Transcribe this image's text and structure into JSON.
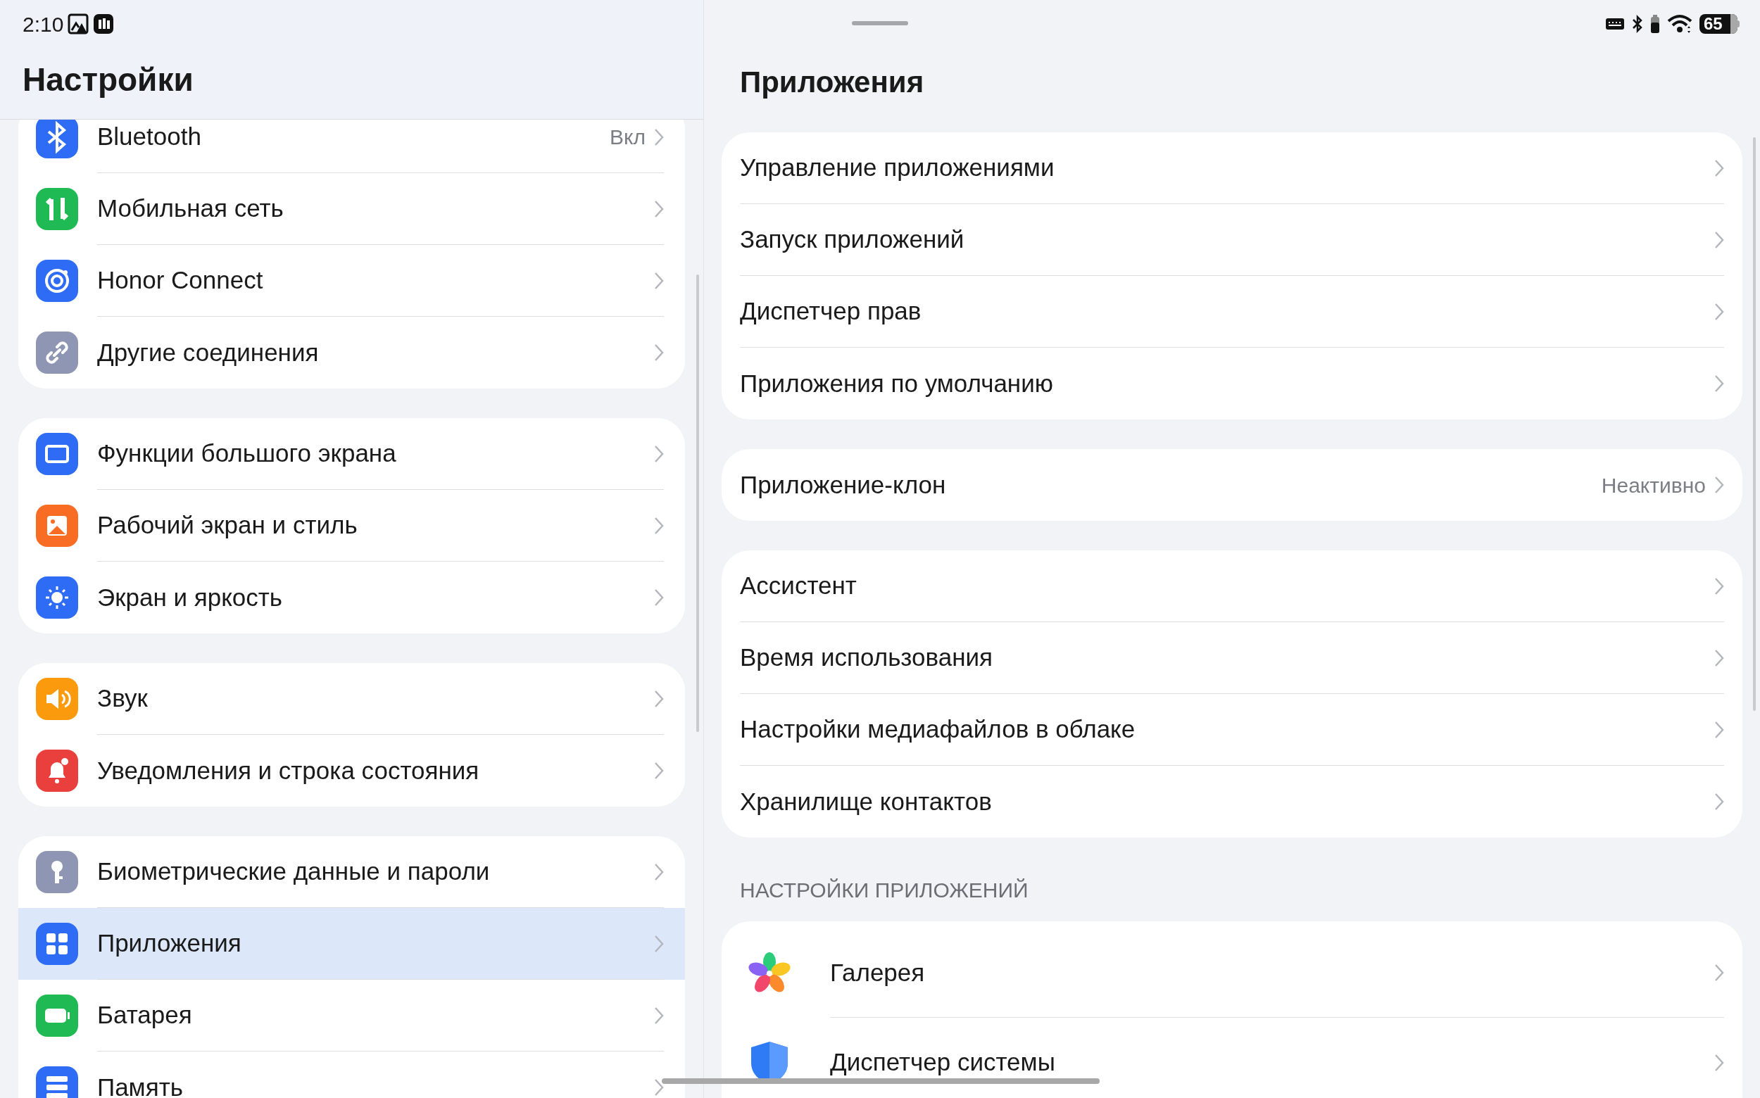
{
  "status_bar": {
    "time": "2:10",
    "battery": "65"
  },
  "left": {
    "title": "Настройки",
    "groups": [
      [
        {
          "kind": "bluetooth",
          "color": "#2f6cf6",
          "label": "Bluetooth",
          "value": "Вкл",
          "selected": false
        },
        {
          "kind": "mobile",
          "color": "#1fba54",
          "label": "Мобильная сеть",
          "selected": false
        },
        {
          "kind": "connect",
          "color": "#2f6cf6",
          "label": "Honor Connect",
          "selected": false
        },
        {
          "kind": "link",
          "color": "#8e96b4",
          "label": "Другие соединения",
          "selected": false
        }
      ],
      [
        {
          "kind": "screen",
          "color": "#2f6cf6",
          "label": "Функции большого экрана",
          "selected": false
        },
        {
          "kind": "wallpaper",
          "color": "#f86c23",
          "label": "Рабочий экран и стиль",
          "selected": false
        },
        {
          "kind": "brightness",
          "color": "#2f6cf6",
          "label": "Экран и яркость",
          "selected": false
        }
      ],
      [
        {
          "kind": "sound",
          "color": "#fb9a0c",
          "label": "Звук",
          "selected": false
        },
        {
          "kind": "notification",
          "color": "#e9403e",
          "label": "Уведомления и строка состояния",
          "selected": false
        }
      ],
      [
        {
          "kind": "key",
          "color": "#8e96b4",
          "label": "Биометрические данные и пароли",
          "selected": false
        },
        {
          "kind": "apps",
          "color": "#2f6cf6",
          "label": "Приложения",
          "selected": true
        },
        {
          "kind": "battery",
          "color": "#1fba54",
          "label": "Батарея",
          "selected": false
        },
        {
          "kind": "storage",
          "color": "#2f6cf6",
          "label": "Память",
          "selected": false
        }
      ]
    ]
  },
  "right": {
    "title": "Приложения",
    "groups": [
      [
        {
          "label": "Управление приложениями"
        },
        {
          "label": "Запуск приложений"
        },
        {
          "label": "Диспетчер прав"
        },
        {
          "label": "Приложения по умолчанию"
        }
      ],
      [
        {
          "label": "Приложение-клон",
          "value": "Неактивно"
        }
      ],
      [
        {
          "label": "Ассистент"
        },
        {
          "label": "Время использования"
        },
        {
          "label": "Настройки медиафайлов в облаке"
        },
        {
          "label": "Хранилище контактов"
        }
      ]
    ],
    "section": "НАСТРОЙКИ ПРИЛОЖЕНИЙ",
    "apps": [
      {
        "kind": "gallery",
        "label": "Галерея"
      },
      {
        "kind": "shield",
        "label": "Диспетчер системы"
      }
    ]
  }
}
